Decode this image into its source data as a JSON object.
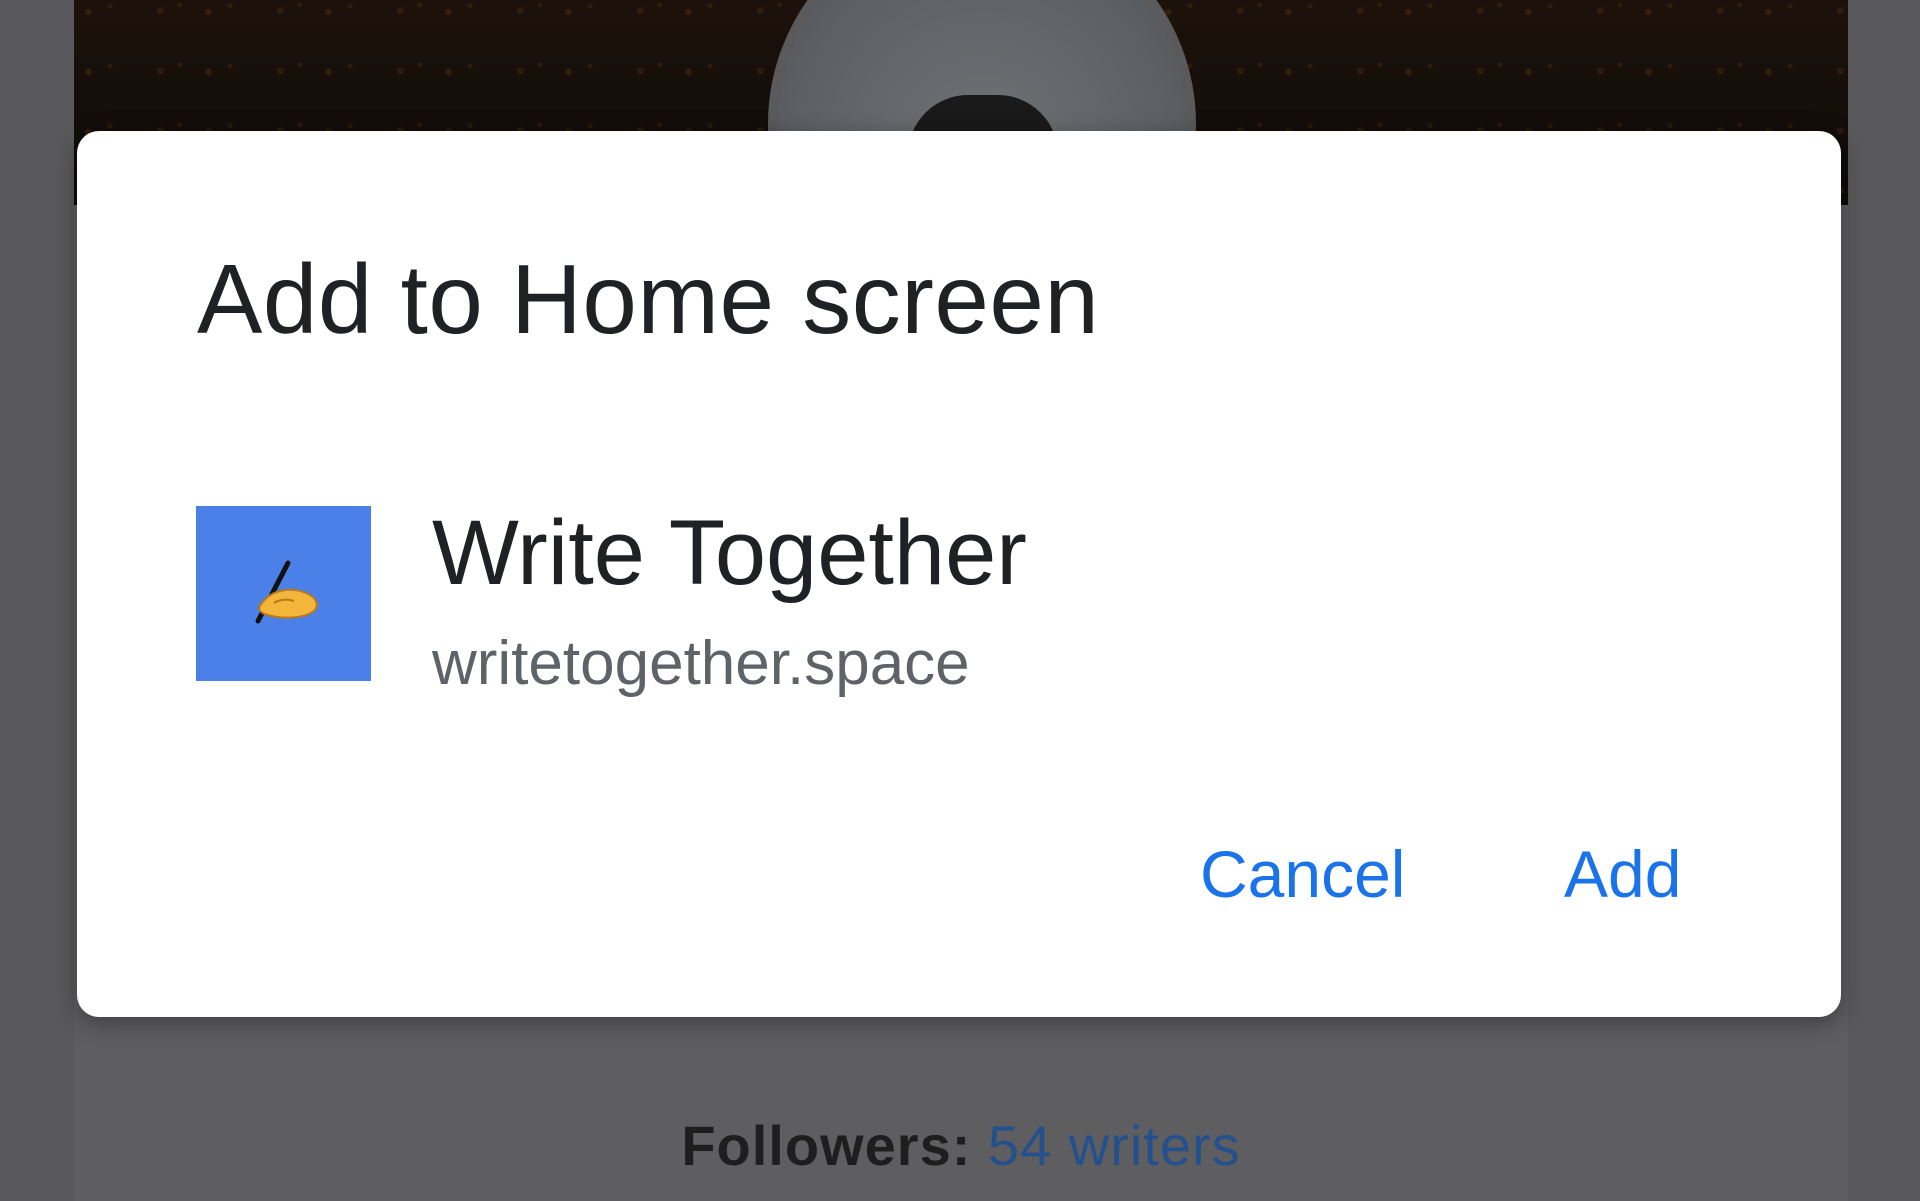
{
  "background": {
    "followers_label": "Followers:",
    "followers_count": "54 writers"
  },
  "dialog": {
    "title": "Add to Home screen",
    "app_name": "Write Together",
    "app_url": "writetogether.space",
    "app_icon": "writing-hand-icon",
    "cancel_label": "Cancel",
    "add_label": "Add"
  },
  "colors": {
    "accent": "#1a73e8",
    "app_icon_bg": "#4a80e8"
  }
}
